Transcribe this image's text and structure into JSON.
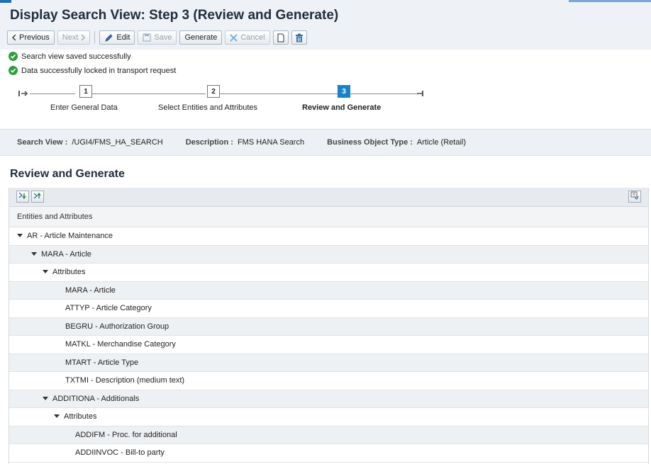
{
  "page": {
    "title": "Display Search View: Step 3  (Review and Generate)"
  },
  "toolbar": {
    "previous_label": "Previous",
    "next_label": "Next",
    "edit_label": "Edit",
    "save_label": "Save",
    "generate_label": "Generate",
    "cancel_label": "Cancel"
  },
  "messages": [
    {
      "text": "Search view saved successfully",
      "icon": "success-check-icon"
    },
    {
      "text": "Data successfully locked in transport request",
      "icon": "success-check-icon"
    }
  ],
  "wizard": {
    "steps": [
      {
        "number": "1",
        "label": "Enter General Data",
        "active": false
      },
      {
        "number": "2",
        "label": "Select Entities and Attributes",
        "active": false
      },
      {
        "number": "3",
        "label": "Review and Generate",
        "active": true
      }
    ]
  },
  "info": {
    "search_view_label": "Search View :",
    "search_view_value": "/UGI4/FMS_HA_SEARCH",
    "description_label": "Description :",
    "description_value": "FMS HANA Search",
    "bo_type_label": "Business Object Type :",
    "bo_type_value": "Article (Retail)"
  },
  "section": {
    "title": "Review and Generate"
  },
  "tree": {
    "header": "Entities and Attributes",
    "rows": [
      {
        "label": "AR - Article Maintenance",
        "level": 0,
        "expandable": true
      },
      {
        "label": "MARA - Article",
        "level": 1,
        "expandable": true
      },
      {
        "label": "Attributes",
        "level": 2,
        "expandable": true
      },
      {
        "label": "MARA - Article",
        "level": 3,
        "expandable": false
      },
      {
        "label": "ATTYP - Article Category",
        "level": 3,
        "expandable": false
      },
      {
        "label": "BEGRU - Authorization Group",
        "level": 3,
        "expandable": false
      },
      {
        "label": "MATKL - Merchandise Category",
        "level": 3,
        "expandable": false
      },
      {
        "label": "MTART - Article Type",
        "level": 3,
        "expandable": false
      },
      {
        "label": "TXTMI - Description (medium text)",
        "level": 3,
        "expandable": false
      },
      {
        "label": "ADDITIONA - Additionals",
        "level": 1,
        "expandable": true
      },
      {
        "label": "Attributes",
        "level": 2,
        "expandable": true
      },
      {
        "label": "ADDIFM - Proc. for additional",
        "level": 3,
        "expandable": false
      },
      {
        "label": "ADDIINVOC - Bill-to party",
        "level": 3,
        "expandable": false
      }
    ]
  },
  "colors": {
    "accent": "#1a82c8",
    "success": "#2e9e3e",
    "delete_icon": "#2c6fb3"
  }
}
